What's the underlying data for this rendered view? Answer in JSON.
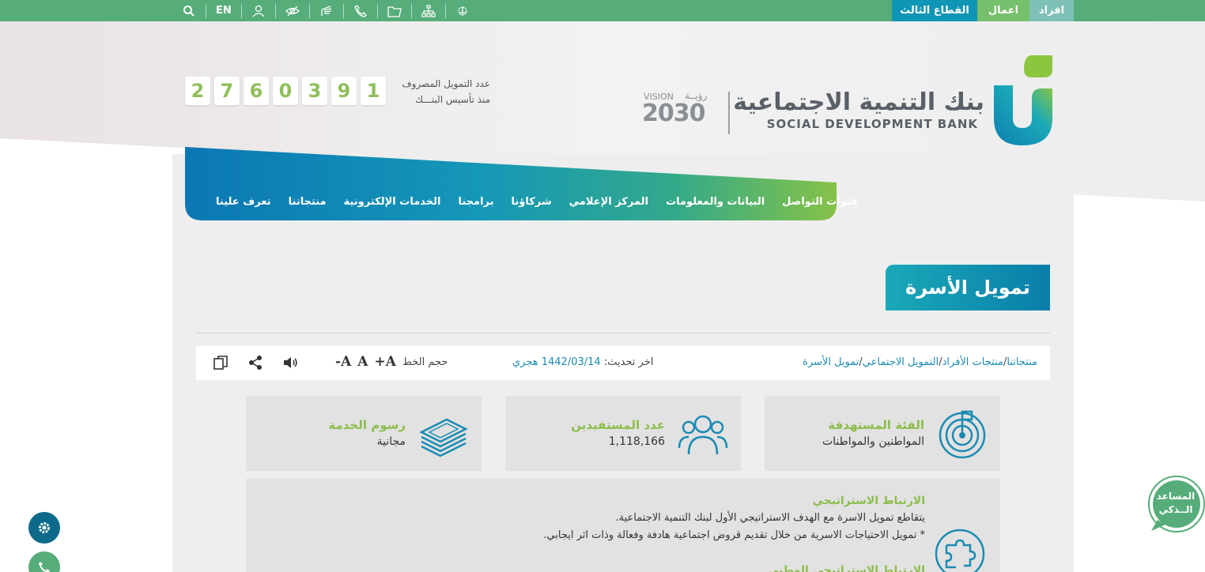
{
  "topbar": {
    "segments": [
      "افراد",
      "اعمال",
      "القطاع الثالث"
    ],
    "language": "EN",
    "icons": [
      "search-icon",
      "user-icon",
      "eye-slash-icon",
      "sign-language-icon",
      "phone-icon",
      "folder-icon",
      "sitemap-icon",
      "emblem-icon"
    ]
  },
  "header": {
    "logo_ar": "بنك التنمية الاجتماعية",
    "logo_en": "SOCIAL DEVELOPMENT BANK",
    "vision_label": "VISION",
    "vision_ar": "رؤيــة",
    "vision_year": "2030",
    "counter_line1": "عدد التمويل المصروف",
    "counter_line2": "منذ تأسيس البنـــك",
    "counter_digits": [
      "2",
      "7",
      "6",
      "0",
      "3",
      "9",
      "1"
    ]
  },
  "nav": {
    "items": [
      "تعرف علينا",
      "منتجاتنا",
      "الخدمات الإلكترونية",
      "برامجنا",
      "شركاؤنا",
      "المركز الإعلامي",
      "البيانات والمعلومات",
      "قنوات التواصل"
    ]
  },
  "page": {
    "title": "تمويل الأسرة",
    "breadcrumb": [
      "منتجاتنا",
      "منتجات الأفراد",
      "التمويل الاجتماعي",
      "تمويل الأسرة"
    ],
    "breadcrumb_sep": "/",
    "updated_label": "اخر تحديث:",
    "updated_value": "1442/03/14 هجري",
    "fontsize_label": "حجم الخط",
    "font_plus": "A+",
    "font_normal": "A",
    "font_minus": "A-"
  },
  "cards": [
    {
      "title": "الفئة المستهدفة",
      "value": "المواطنين والمواطنات",
      "icon": "target-icon"
    },
    {
      "title": "عدد المستفيدين",
      "value": "1,118,166",
      "icon": "users-icon"
    },
    {
      "title": "رسوم الخدمة",
      "value": "مجانية",
      "icon": "money-stack-icon"
    }
  ],
  "strategic": {
    "title": "الارتباط الاستراتيجي",
    "line1": "يتقاطع تمويل الاسرة مع الهدف الاستراتيجي الأول لبنك التنمية الاجتماعية.",
    "line2": "* تمويل الاحتياجات الاسرية من خلال تقديم قروض اجتماعية هادفة وفعالة وذات اثر ايجابي.",
    "line3": "الارتباط الاستراتيجي الوطني",
    "icon": "puzzle-icon"
  },
  "assistant": {
    "line1": "المساعد",
    "line2": "الــذكي"
  },
  "colors": {
    "green": "#56ad7a",
    "teal": "#0f95b5",
    "lightgreen": "#8dbd4c",
    "grey": "#eeeeee"
  }
}
